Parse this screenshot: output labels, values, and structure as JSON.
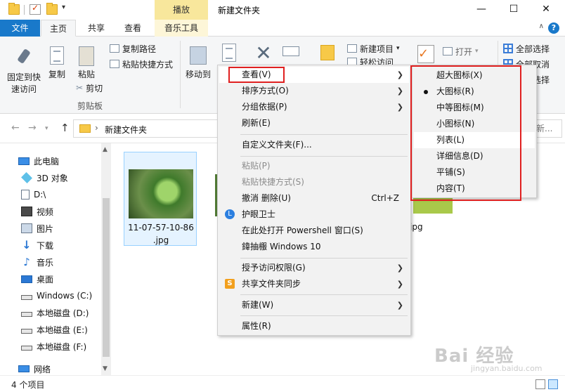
{
  "titlebar": {
    "context_tab": "播放",
    "title": "新建文件夹",
    "minimize": "—",
    "maximize": "☐",
    "close": "✕"
  },
  "ribbon_tabs": {
    "file": "文件",
    "home": "主页",
    "share": "共享",
    "view": "查看",
    "music_tools": "音乐工具",
    "collapse": "∧",
    "help": "?"
  },
  "ribbon": {
    "pin_label": "固定到快\n速访问",
    "pin_line1": "固定到快",
    "pin_line2": "速访问",
    "copy": "复制",
    "paste": "粘贴",
    "copy_path": "复制路径",
    "paste_shortcut": "粘贴快捷方式",
    "cut": "剪切",
    "clipboard_group": "剪贴板",
    "move_to": "移动到",
    "new_item": "新建项目",
    "open": "打开",
    "select_all": "全部选择",
    "frag_partial1": "全部取消",
    "frag_partial2": "反向选择",
    "easy_access_frag": "轻松访问"
  },
  "address": {
    "path": "新建文件夹",
    "search_frag": "新..."
  },
  "nav_pane": {
    "items": [
      {
        "label": "此电脑",
        "icon": "computer-icon"
      },
      {
        "label": "3D 对象",
        "icon": "cube-icon"
      },
      {
        "label": "D:\\",
        "icon": "document-icon"
      },
      {
        "label": "视频",
        "icon": "video-icon"
      },
      {
        "label": "图片",
        "icon": "picture-icon"
      },
      {
        "label": "下载",
        "icon": "download-icon"
      },
      {
        "label": "音乐",
        "icon": "music-icon"
      },
      {
        "label": "桌面",
        "icon": "desktop-icon"
      },
      {
        "label": "Windows (C:)",
        "icon": "drive-icon"
      },
      {
        "label": "本地磁盘 (D:)",
        "icon": "drive-icon"
      },
      {
        "label": "本地磁盘 (E:)",
        "icon": "drive-icon"
      },
      {
        "label": "本地磁盘 (F:)",
        "icon": "drive-icon"
      },
      {
        "label": "网络",
        "icon": "network-icon"
      }
    ]
  },
  "content": {
    "file1_name_line1": "11-07-57-10-86",
    "file1_name_line2": ".jpg",
    "partial_name": "ng.jpg"
  },
  "status": {
    "item_count": "4 个项目"
  },
  "context_menu": {
    "items": [
      {
        "label": "查看(V)",
        "submenu": true
      },
      {
        "label": "排序方式(O)",
        "submenu": true
      },
      {
        "label": "分组依据(P)",
        "submenu": true
      },
      {
        "label": "刷新(E)"
      },
      {
        "label": "自定义文件夹(F)..."
      },
      {
        "label": "粘贴(P)",
        "disabled": true
      },
      {
        "label": "粘贴快捷方式(S)",
        "disabled": true
      },
      {
        "label": "撤消 删除(U)",
        "shortcut": "Ctrl+Z"
      },
      {
        "label": "护眼卫士"
      },
      {
        "label": "在此处打开 Powershell 窗口(S)"
      },
      {
        "label": "鍏抽棴 Windows 10"
      },
      {
        "label": "授予访问权限(G)",
        "submenu": true
      },
      {
        "label": "共享文件夹同步",
        "submenu": true
      },
      {
        "label": "新建(W)",
        "submenu": true
      },
      {
        "label": "属性(R)"
      }
    ]
  },
  "view_submenu": {
    "items": [
      {
        "label": "超大图标(X)"
      },
      {
        "label": "大图标(R)",
        "selected": true
      },
      {
        "label": "中等图标(M)"
      },
      {
        "label": "小图标(N)"
      },
      {
        "label": "列表(L)"
      },
      {
        "label": "详细信息(D)"
      },
      {
        "label": "平铺(S)"
      },
      {
        "label": "内容(T)"
      }
    ]
  },
  "watermark": {
    "main": "Bai 经验",
    "sub": "jingyan.baidu.com"
  },
  "colors": {
    "accent": "#1979ca",
    "highlight_red": "#e02020",
    "context_tab_bg": "#f8e79c"
  }
}
